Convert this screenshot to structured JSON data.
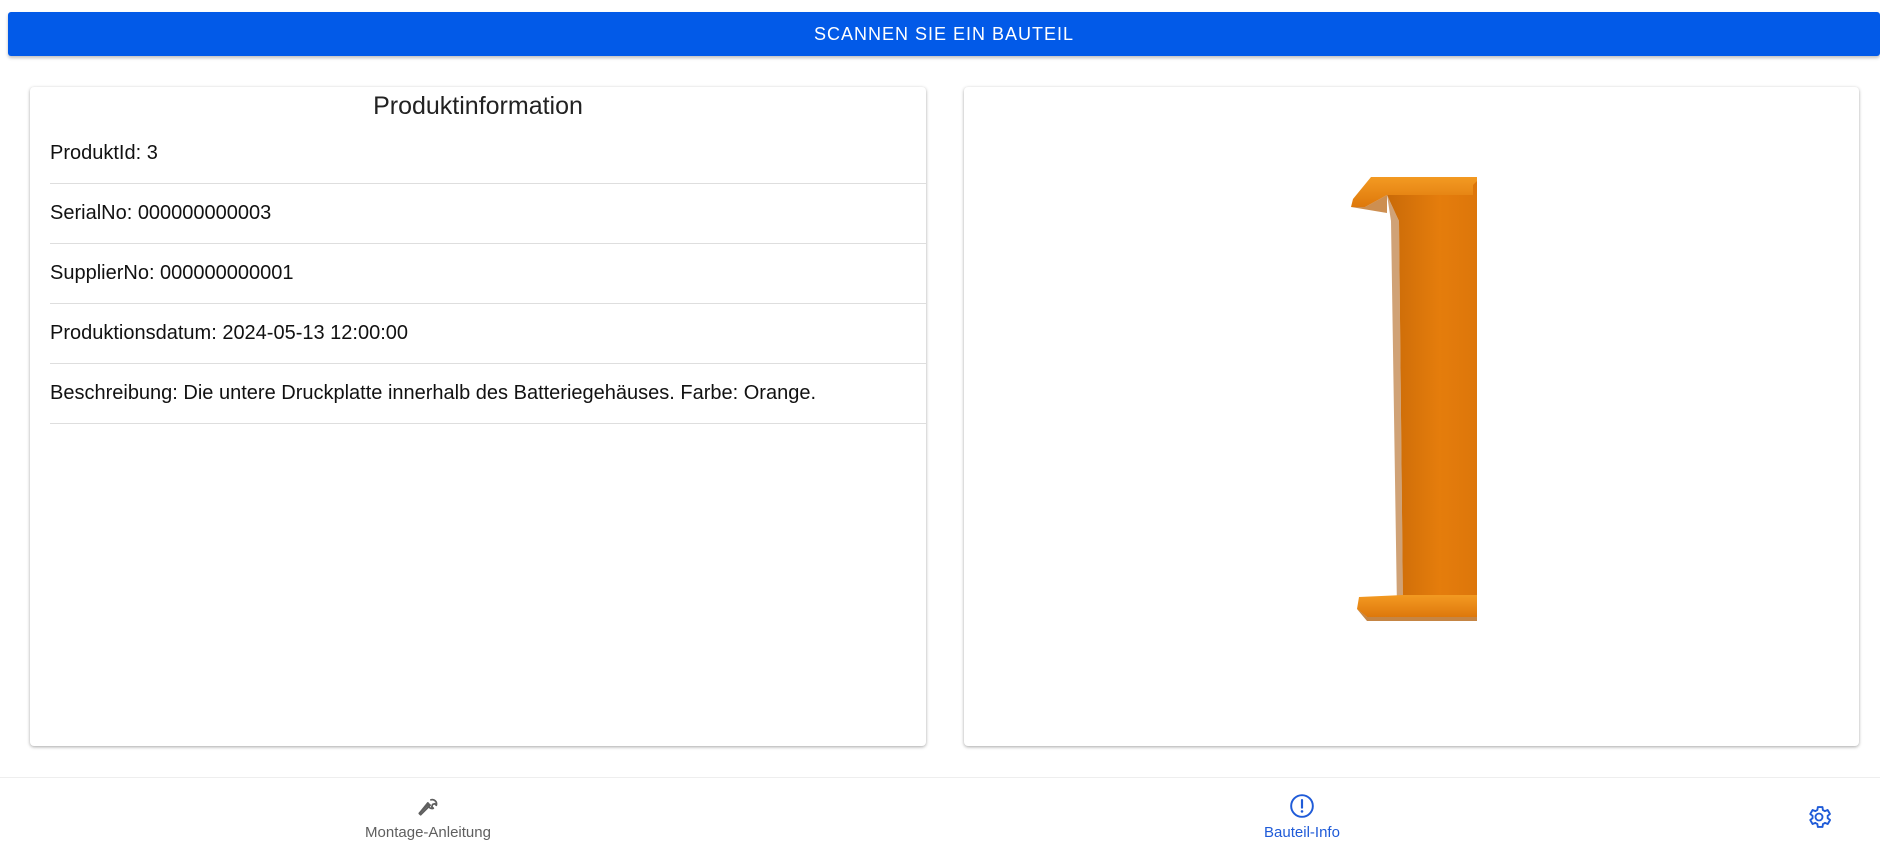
{
  "scan_button": {
    "label": "SCANNEN SIE EIN BAUTEIL"
  },
  "product_info": {
    "title": "Produktinformation",
    "rows": [
      "ProduktId: 3",
      "SerialNo: 000000000003",
      "SupplierNo: 000000000001",
      "Produktionsdatum: 2024-05-13 12:00:00",
      "Beschreibung: Die untere Druckplatte innerhalb des Batteriegehäuses. Farbe: Orange."
    ]
  },
  "part_image": {
    "icon": "orange-pressure-plate-image",
    "color": "#e57d0c"
  },
  "bottom_nav": {
    "items": [
      {
        "label": "Montage-Anleitung",
        "icon": "wrench-icon",
        "active": false
      },
      {
        "label": "Bauteil-Info",
        "icon": "info-circle-icon",
        "active": true
      }
    ],
    "settings_icon": "gear-icon",
    "active_color": "#1f5bd8",
    "inactive_color": "#5f5f5f"
  },
  "accent_color": "#025ae8"
}
